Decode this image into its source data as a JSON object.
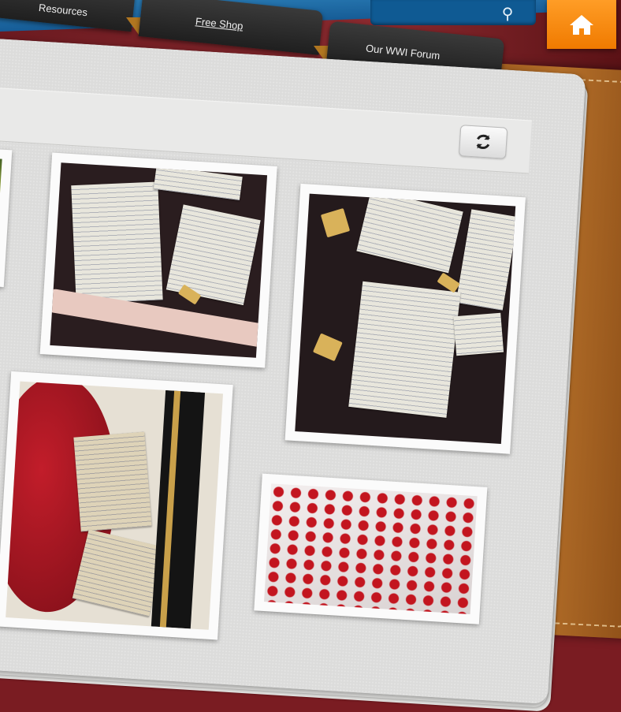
{
  "nav": {
    "tabs": [
      {
        "label": "Resources"
      },
      {
        "label": "Free Shop"
      },
      {
        "label": "Our WWI Forum"
      }
    ]
  },
  "header": {
    "search_icon": "search-icon",
    "home_icon": "home-icon"
  },
  "toolbar": {
    "refresh_icon": "refresh-icon"
  },
  "gallery": {
    "photos": [
      {
        "subject": "left-edge-photo-top"
      },
      {
        "subject": "handwritten-letters-board"
      },
      {
        "subject": "handwritten-letters-with-tags"
      },
      {
        "subject": "poppy-and-letters"
      },
      {
        "subject": "red-paper-poppies"
      }
    ]
  },
  "colors": {
    "accent_orange": "#f07a00",
    "header_blue": "#165c96",
    "tab_dark": "#2a2a2a",
    "folder_brown": "#9c5a1e",
    "poppy_red": "#c81e2c"
  }
}
